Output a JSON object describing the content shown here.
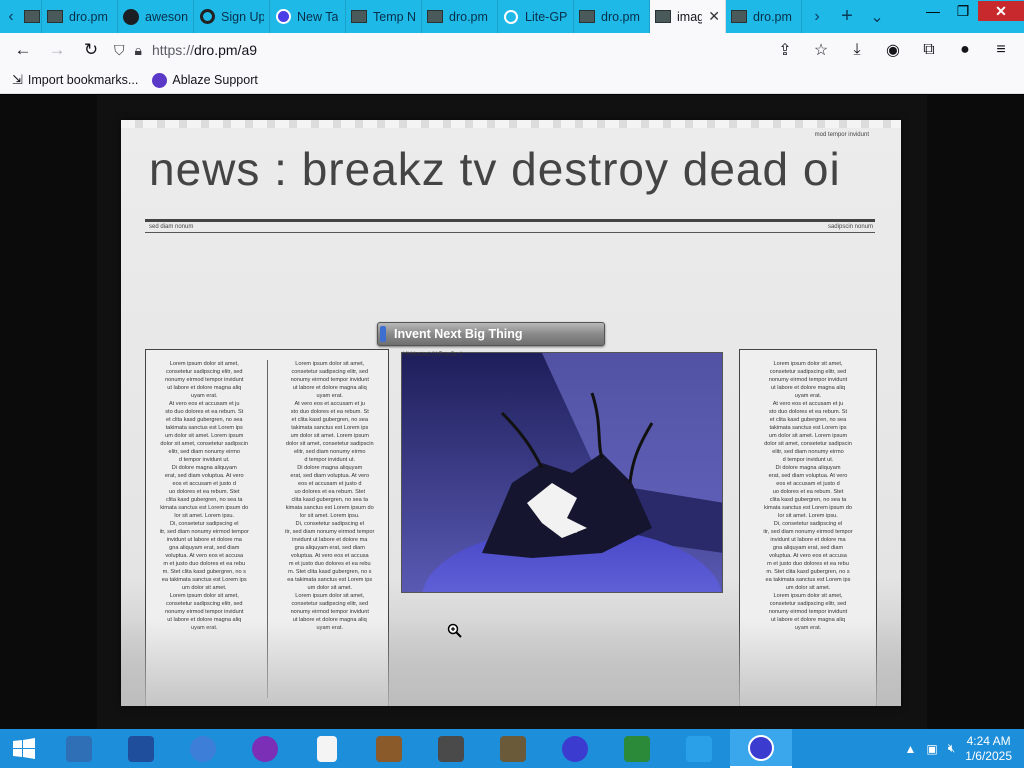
{
  "browser": {
    "tabs": [
      {
        "label": "",
        "icon": "back-arrow-icon"
      },
      {
        "label": "dro.pm",
        "icon": "film-icon"
      },
      {
        "label": "aweson",
        "icon": "github-icon"
      },
      {
        "label": "Sign Up",
        "icon": "openai-icon"
      },
      {
        "label": "New Ta",
        "icon": "firefox-icon"
      },
      {
        "label": "Temp N",
        "icon": "film-icon"
      },
      {
        "label": "dro.pm",
        "icon": "film-icon"
      },
      {
        "label": "Lite-GP",
        "icon": "lite-icon"
      },
      {
        "label": "dro.pm",
        "icon": "film-icon"
      },
      {
        "label": "imag",
        "icon": "film-icon",
        "active": true
      },
      {
        "label": "dro.pm",
        "icon": "film-icon"
      }
    ],
    "tab_close_glyph": "✕",
    "url": "https://dro.pm/a9",
    "url_prefix": "https://",
    "url_host": "dro.pm/a9",
    "bookmarks": [
      {
        "label": "Import bookmarks...",
        "icon": "import-icon"
      },
      {
        "label": "Ablaze Support",
        "icon": "ablaze-icon"
      }
    ]
  },
  "newspaper": {
    "headline": "news : breakz tv destroy dead oi",
    "top_label": "mod tempor invidunt",
    "sub_left": "sed diam nonum",
    "sub_right": "sadipscin nonum",
    "banner": "Invent Next Big Thing",
    "photo_caption": "Hi-Hosted (Y-Pro-Gr -) ",
    "column_text": "Lorem ipsum dolor sit amet,\nconsetetur sadipscing elitr, sed\nnonumy eirmod tempor invidunt\nut labore et dolore magna aliq\nuyam erat.\nAt vero eos et accusam et ju\nsto duo dolores et ea rebum. St\net clita kasd gubergren, no sea\ntakimata sanctus est Lorem ips\num dolor sit amet. Lorem ipsum\ndolor sit amet, consetetur sadipscin\nelitr, sed diam nonumy eirmo\nd tempor invidunt ut.\nDi dolore magna aliquyam\nerat, sed diam voluptua. At vero\neos et accusam et justo d\nuo dolores et ea rebum. Stet\nclita kasd gubergren, no sea ta\nkimata sanctus est Lorem ipsum do\nlor sit amet. Lorem ipsu.\nDi, consetetur sadipscing el\nitr, sed diam nonumy eirmod tempor\ninvidunt ut labore et dolore ma\ngna aliquyam erat, sed diam\nvoluptua. At vero eos et accusa\nm et justo duo dolores et ea rebu\nm. Stet clita kasd gubergren, no s\nea takimata sanctus est Lorem ips\num dolor sit amet.\nLorem ipsum dolor sit amet,\nconsetetur sadipscing elitr, sed\nnonumy eirmod tempor invidunt\nut labore et dolore magna aliq\nuyam erat."
  },
  "taskbar": {
    "items": [
      {
        "name": "file-explorer-icon",
        "color": "#2f6fb5"
      },
      {
        "name": "powershell-icon",
        "color": "#1f4f9c"
      },
      {
        "name": "sync-icon",
        "color": "#3d7ed8"
      },
      {
        "name": "yahoo-messenger-icon",
        "color": "#7a2fb6"
      },
      {
        "name": "blank-document-icon",
        "color": "#f4f4f4"
      },
      {
        "name": "minecraft-chest-icon",
        "color": "#8a5a2b"
      },
      {
        "name": "camera-app-icon",
        "color": "#4a4a4a"
      },
      {
        "name": "gimp-icon",
        "color": "#6b5a3a"
      },
      {
        "name": "virus-icon",
        "color": "#3b3bd0"
      },
      {
        "name": "computer-99-icon",
        "color": "#2a8a3a"
      },
      {
        "name": "windsurf-icon",
        "color": "#2aa0e8"
      },
      {
        "name": "ablaze-browser-icon",
        "color": "#3b3bd0",
        "active": true
      }
    ],
    "clock_time": "4:24 AM",
    "clock_date": "1/6/2025"
  },
  "colors": {
    "tab_strip": "#1fb9e8",
    "taskbar": "#1d8ed9",
    "close_button": "#c7292c"
  }
}
